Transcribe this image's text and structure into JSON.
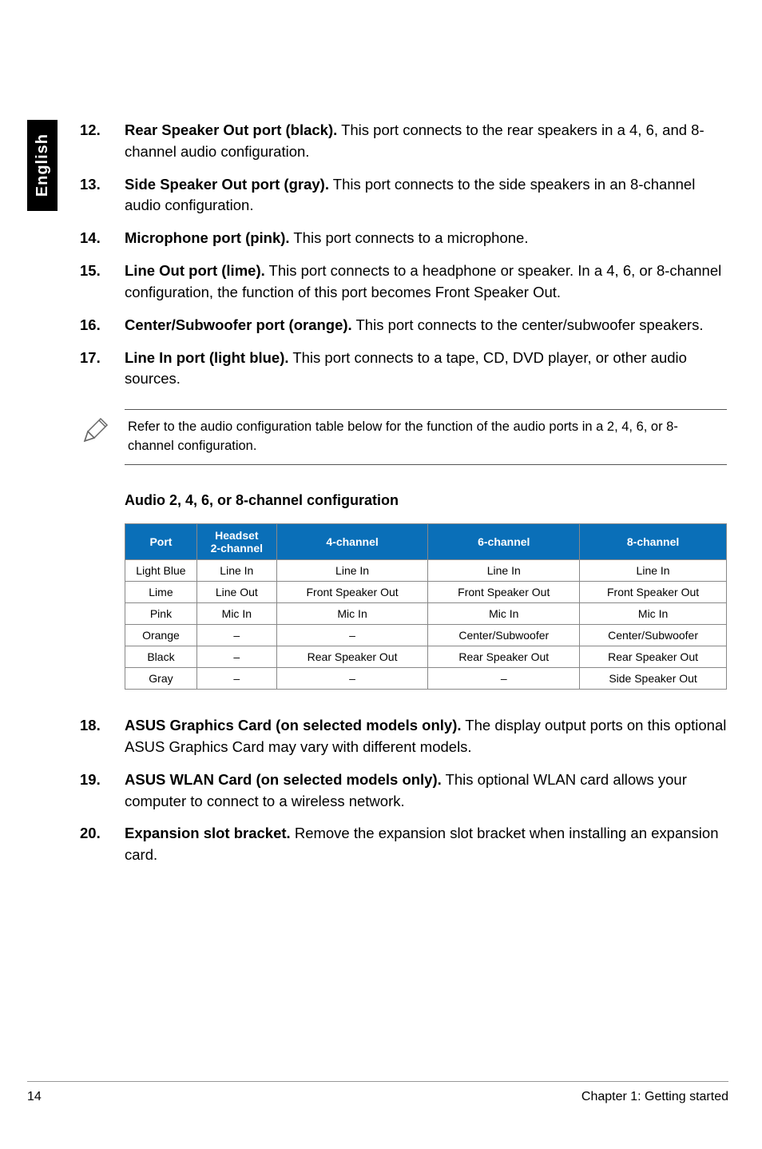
{
  "sidebar": {
    "label": "English"
  },
  "items": [
    {
      "num": "12.",
      "lead": "Rear Speaker Out port (black).",
      "text": " This port connects to the rear speakers in a 4, 6, and 8-channel audio configuration."
    },
    {
      "num": "13.",
      "lead": "Side Speaker Out port (gray).",
      "text": " This port connects to the side speakers in an 8-channel audio configuration."
    },
    {
      "num": "14.",
      "lead": "Microphone port (pink).",
      "text": " This port connects to a microphone."
    },
    {
      "num": "15.",
      "lead": "Line Out port (lime).",
      "text": " This port connects to a headphone or speaker. In a 4, 6, or 8-channel configuration, the function of this port becomes Front Speaker Out."
    },
    {
      "num": "16.",
      "lead": "Center/Subwoofer port (orange).",
      "text": " This port connects to the center/subwoofer speakers."
    },
    {
      "num": "17.",
      "lead": "Line In port (light blue).",
      "text": " This port connects to a tape, CD, DVD player, or other audio sources."
    }
  ],
  "note": "Refer to the audio configuration table below for the function of the audio ports in a 2, 4, 6, or 8-channel configuration.",
  "table_heading": "Audio 2, 4, 6, or 8-channel configuration",
  "table": {
    "headers": {
      "port": "Port",
      "h2a": "Headset",
      "h2b": "2-channel",
      "h4": "4-channel",
      "h6": "6-channel",
      "h8": "8-channel"
    },
    "rows": [
      {
        "port": "Light Blue",
        "c2": "Line In",
        "c4": "Line In",
        "c6": "Line In",
        "c8": "Line In"
      },
      {
        "port": "Lime",
        "c2": "Line Out",
        "c4": "Front Speaker Out",
        "c6": "Front Speaker Out",
        "c8": "Front Speaker Out"
      },
      {
        "port": "Pink",
        "c2": "Mic In",
        "c4": "Mic In",
        "c6": "Mic In",
        "c8": "Mic In"
      },
      {
        "port": "Orange",
        "c2": "–",
        "c4": "–",
        "c6": "Center/Subwoofer",
        "c8": "Center/Subwoofer"
      },
      {
        "port": "Black",
        "c2": "–",
        "c4": "Rear Speaker Out",
        "c6": "Rear Speaker Out",
        "c8": "Rear Speaker Out"
      },
      {
        "port": "Gray",
        "c2": "–",
        "c4": "–",
        "c6": "–",
        "c8": "Side Speaker Out"
      }
    ]
  },
  "items2": [
    {
      "num": "18.",
      "lead": "ASUS Graphics Card (on selected models only).",
      "text": " The display output ports on this optional ASUS Graphics Card may vary with different models."
    },
    {
      "num": "19.",
      "lead": "ASUS WLAN Card (on selected models only).",
      "text": " This optional WLAN card allows your computer to connect to a wireless network."
    },
    {
      "num": "20.",
      "lead": "Expansion slot bracket.",
      "text": " Remove the expansion slot bracket when installing an expansion card."
    }
  ],
  "footer": {
    "page": "14",
    "chapter": "Chapter 1: Getting started"
  },
  "chart_data": {
    "type": "table",
    "title": "Audio 2, 4, 6, or 8-channel configuration",
    "columns": [
      "Port",
      "Headset 2-channel",
      "4-channel",
      "6-channel",
      "8-channel"
    ],
    "rows": [
      [
        "Light Blue",
        "Line In",
        "Line In",
        "Line In",
        "Line In"
      ],
      [
        "Lime",
        "Line Out",
        "Front Speaker Out",
        "Front Speaker Out",
        "Front Speaker Out"
      ],
      [
        "Pink",
        "Mic In",
        "Mic In",
        "Mic In",
        "Mic In"
      ],
      [
        "Orange",
        "–",
        "–",
        "Center/Subwoofer",
        "Center/Subwoofer"
      ],
      [
        "Black",
        "–",
        "Rear Speaker Out",
        "Rear Speaker Out",
        "Rear Speaker Out"
      ],
      [
        "Gray",
        "–",
        "–",
        "–",
        "Side Speaker Out"
      ]
    ]
  }
}
